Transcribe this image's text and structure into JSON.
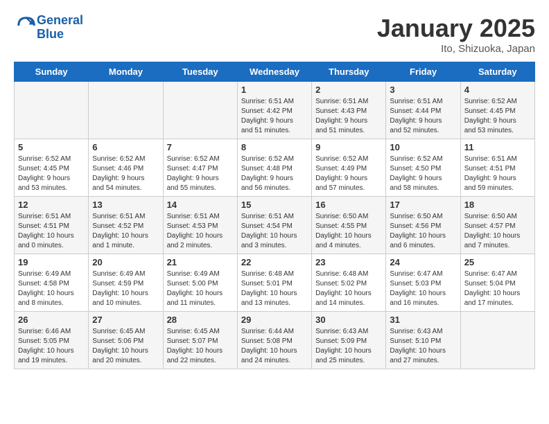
{
  "header": {
    "logo_line1": "General",
    "logo_line2": "Blue",
    "month": "January 2025",
    "location": "Ito, Shizuoka, Japan"
  },
  "weekdays": [
    "Sunday",
    "Monday",
    "Tuesday",
    "Wednesday",
    "Thursday",
    "Friday",
    "Saturday"
  ],
  "weeks": [
    [
      {
        "day": "",
        "info": ""
      },
      {
        "day": "",
        "info": ""
      },
      {
        "day": "",
        "info": ""
      },
      {
        "day": "1",
        "info": "Sunrise: 6:51 AM\nSunset: 4:42 PM\nDaylight: 9 hours\nand 51 minutes."
      },
      {
        "day": "2",
        "info": "Sunrise: 6:51 AM\nSunset: 4:43 PM\nDaylight: 9 hours\nand 51 minutes."
      },
      {
        "day": "3",
        "info": "Sunrise: 6:51 AM\nSunset: 4:44 PM\nDaylight: 9 hours\nand 52 minutes."
      },
      {
        "day": "4",
        "info": "Sunrise: 6:52 AM\nSunset: 4:45 PM\nDaylight: 9 hours\nand 53 minutes."
      }
    ],
    [
      {
        "day": "5",
        "info": "Sunrise: 6:52 AM\nSunset: 4:45 PM\nDaylight: 9 hours\nand 53 minutes."
      },
      {
        "day": "6",
        "info": "Sunrise: 6:52 AM\nSunset: 4:46 PM\nDaylight: 9 hours\nand 54 minutes."
      },
      {
        "day": "7",
        "info": "Sunrise: 6:52 AM\nSunset: 4:47 PM\nDaylight: 9 hours\nand 55 minutes."
      },
      {
        "day": "8",
        "info": "Sunrise: 6:52 AM\nSunset: 4:48 PM\nDaylight: 9 hours\nand 56 minutes."
      },
      {
        "day": "9",
        "info": "Sunrise: 6:52 AM\nSunset: 4:49 PM\nDaylight: 9 hours\nand 57 minutes."
      },
      {
        "day": "10",
        "info": "Sunrise: 6:52 AM\nSunset: 4:50 PM\nDaylight: 9 hours\nand 58 minutes."
      },
      {
        "day": "11",
        "info": "Sunrise: 6:51 AM\nSunset: 4:51 PM\nDaylight: 9 hours\nand 59 minutes."
      }
    ],
    [
      {
        "day": "12",
        "info": "Sunrise: 6:51 AM\nSunset: 4:51 PM\nDaylight: 10 hours\nand 0 minutes."
      },
      {
        "day": "13",
        "info": "Sunrise: 6:51 AM\nSunset: 4:52 PM\nDaylight: 10 hours\nand 1 minute."
      },
      {
        "day": "14",
        "info": "Sunrise: 6:51 AM\nSunset: 4:53 PM\nDaylight: 10 hours\nand 2 minutes."
      },
      {
        "day": "15",
        "info": "Sunrise: 6:51 AM\nSunset: 4:54 PM\nDaylight: 10 hours\nand 3 minutes."
      },
      {
        "day": "16",
        "info": "Sunrise: 6:50 AM\nSunset: 4:55 PM\nDaylight: 10 hours\nand 4 minutes."
      },
      {
        "day": "17",
        "info": "Sunrise: 6:50 AM\nSunset: 4:56 PM\nDaylight: 10 hours\nand 6 minutes."
      },
      {
        "day": "18",
        "info": "Sunrise: 6:50 AM\nSunset: 4:57 PM\nDaylight: 10 hours\nand 7 minutes."
      }
    ],
    [
      {
        "day": "19",
        "info": "Sunrise: 6:49 AM\nSunset: 4:58 PM\nDaylight: 10 hours\nand 8 minutes."
      },
      {
        "day": "20",
        "info": "Sunrise: 6:49 AM\nSunset: 4:59 PM\nDaylight: 10 hours\nand 10 minutes."
      },
      {
        "day": "21",
        "info": "Sunrise: 6:49 AM\nSunset: 5:00 PM\nDaylight: 10 hours\nand 11 minutes."
      },
      {
        "day": "22",
        "info": "Sunrise: 6:48 AM\nSunset: 5:01 PM\nDaylight: 10 hours\nand 13 minutes."
      },
      {
        "day": "23",
        "info": "Sunrise: 6:48 AM\nSunset: 5:02 PM\nDaylight: 10 hours\nand 14 minutes."
      },
      {
        "day": "24",
        "info": "Sunrise: 6:47 AM\nSunset: 5:03 PM\nDaylight: 10 hours\nand 16 minutes."
      },
      {
        "day": "25",
        "info": "Sunrise: 6:47 AM\nSunset: 5:04 PM\nDaylight: 10 hours\nand 17 minutes."
      }
    ],
    [
      {
        "day": "26",
        "info": "Sunrise: 6:46 AM\nSunset: 5:05 PM\nDaylight: 10 hours\nand 19 minutes."
      },
      {
        "day": "27",
        "info": "Sunrise: 6:45 AM\nSunset: 5:06 PM\nDaylight: 10 hours\nand 20 minutes."
      },
      {
        "day": "28",
        "info": "Sunrise: 6:45 AM\nSunset: 5:07 PM\nDaylight: 10 hours\nand 22 minutes."
      },
      {
        "day": "29",
        "info": "Sunrise: 6:44 AM\nSunset: 5:08 PM\nDaylight: 10 hours\nand 24 minutes."
      },
      {
        "day": "30",
        "info": "Sunrise: 6:43 AM\nSunset: 5:09 PM\nDaylight: 10 hours\nand 25 minutes."
      },
      {
        "day": "31",
        "info": "Sunrise: 6:43 AM\nSunset: 5:10 PM\nDaylight: 10 hours\nand 27 minutes."
      },
      {
        "day": "",
        "info": ""
      }
    ]
  ]
}
